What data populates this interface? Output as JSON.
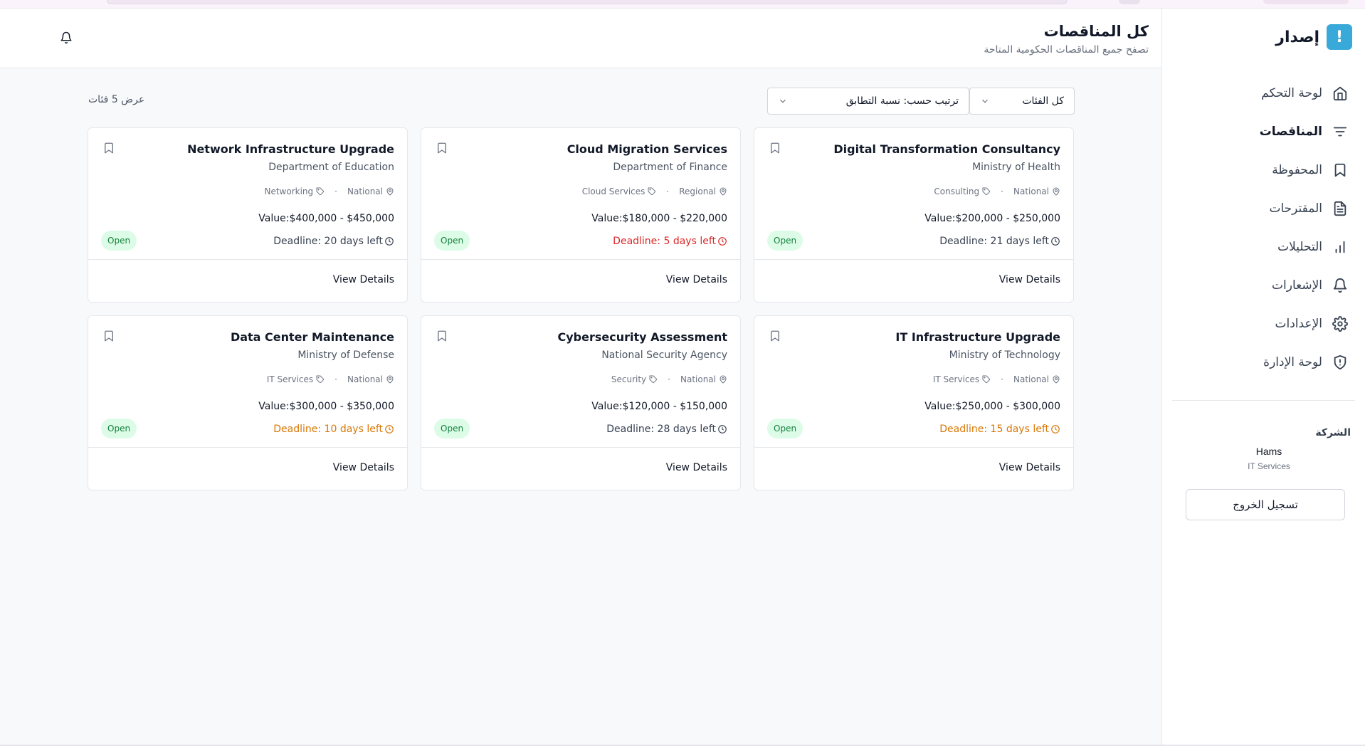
{
  "brand": {
    "name": "إصدار",
    "badge": "!"
  },
  "sidebar": {
    "items": [
      {
        "label": "لوحة التحكم",
        "icon": "home-icon"
      },
      {
        "label": "المناقصات",
        "icon": "filter-icon",
        "active": true
      },
      {
        "label": "المحفوظة",
        "icon": "bookmark-icon"
      },
      {
        "label": "المقترحات",
        "icon": "document-icon"
      },
      {
        "label": "التحليلات",
        "icon": "bar-chart-icon"
      },
      {
        "label": "الإشعارات",
        "icon": "bell-icon"
      },
      {
        "label": "الإعدادات",
        "icon": "gear-icon"
      },
      {
        "label": "لوحة الإدارة",
        "icon": "shield-alert-icon"
      }
    ],
    "company": {
      "label": "الشركة",
      "name": "Hams",
      "sector": "IT Services"
    },
    "logout_label": "تسجيل الخروج"
  },
  "header": {
    "title": "كل المناقصات",
    "subtitle": "تصفح جميع المناقصات الحكومية المتاحة"
  },
  "toolbar": {
    "category_select": "كل الفئات",
    "sort_select": "ترتيب حسب: نسبة التطابق",
    "count_text": "عرض 5 فئات"
  },
  "colors": {
    "accent": "#38a9d8",
    "open_badge_bg": "#dcfce7",
    "open_badge_text": "#15803d",
    "deadline_urgent": "#dc2626",
    "deadline_warning": "#d97706"
  },
  "tenders": [
    {
      "title": "Digital Transformation Consultancy",
      "department": "Ministry of Health",
      "category": "Consulting",
      "scope": "National",
      "value": "Value:$200,000 - $250,000",
      "deadline": "Deadline: 21 days left",
      "deadline_status": "normal",
      "status": "Open",
      "action": "View Details"
    },
    {
      "title": "Cloud Migration Services",
      "department": "Department of Finance",
      "category": "Cloud Services",
      "scope": "Regional",
      "value": "Value:$180,000 - $220,000",
      "deadline": "Deadline: 5 days left",
      "deadline_status": "urgent",
      "status": "Open",
      "action": "View Details"
    },
    {
      "title": "Network Infrastructure Upgrade",
      "department": "Department of Education",
      "category": "Networking",
      "scope": "National",
      "value": "Value:$400,000 - $450,000",
      "deadline": "Deadline: 20 days left",
      "deadline_status": "normal",
      "status": "Open",
      "action": "View Details"
    },
    {
      "title": "IT Infrastructure Upgrade",
      "department": "Ministry of Technology",
      "category": "IT Services",
      "scope": "National",
      "value": "Value:$250,000 - $300,000",
      "deadline": "Deadline: 15 days left",
      "deadline_status": "warning",
      "status": "Open",
      "action": "View Details"
    },
    {
      "title": "Cybersecurity Assessment",
      "department": "National Security Agency",
      "category": "Security",
      "scope": "National",
      "value": "Value:$120,000 - $150,000",
      "deadline": "Deadline: 28 days left",
      "deadline_status": "normal",
      "status": "Open",
      "action": "View Details"
    },
    {
      "title": "Data Center Maintenance",
      "department": "Ministry of Defense",
      "category": "IT Services",
      "scope": "National",
      "value": "Value:$300,000 - $350,000",
      "deadline": "Deadline: 10 days left",
      "deadline_status": "warning",
      "status": "Open",
      "action": "View Details"
    }
  ]
}
